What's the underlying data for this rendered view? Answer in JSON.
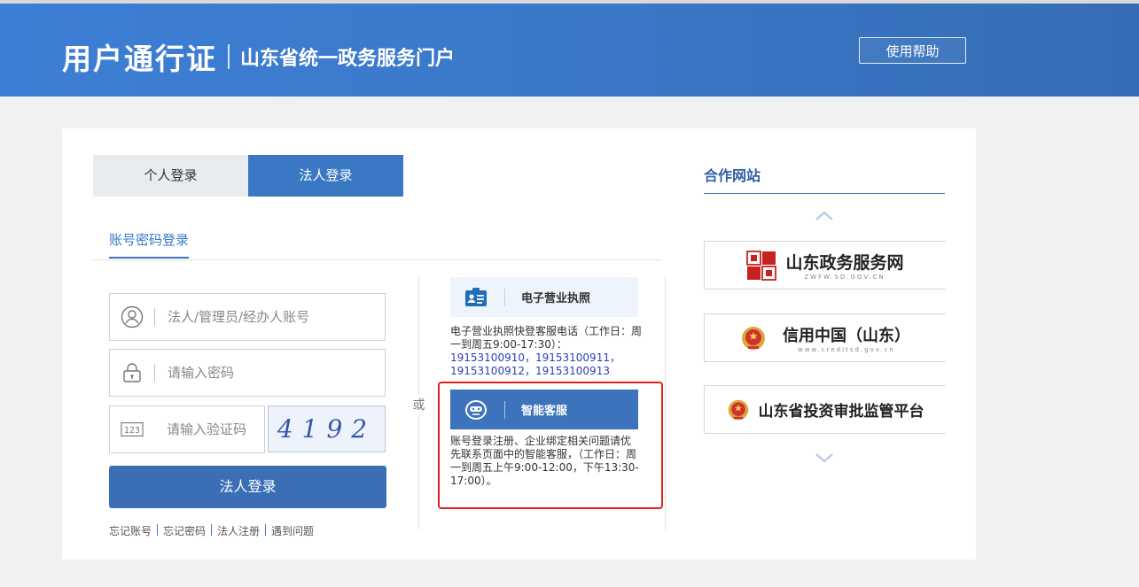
{
  "header": {
    "title": "用户通行证",
    "subtitle": "山东省统一政务服务门户",
    "help_label": "使用帮助"
  },
  "login": {
    "tabs": [
      {
        "label": "个人登录",
        "active": false
      },
      {
        "label": "法人登录",
        "active": true
      }
    ],
    "subnav_label": "账号密码登录",
    "account_placeholder": "法人/管理员/经办人账号",
    "password_placeholder": "请输入密码",
    "captcha_placeholder": "请输入验证码",
    "captcha_text": "4192",
    "submit_label": "法人登录",
    "links": [
      "忘记账号",
      "忘记密码",
      "法人注册",
      "遇到问题"
    ],
    "or_label": "或"
  },
  "info": {
    "license_title": "电子营业执照",
    "license_text": "电子营业执照快登客服电话（工作日：周一到周五9:00-17:30）：",
    "license_phones": "19153100910，19153100911，19153100912，19153100913",
    "service_title": "智能客服",
    "service_text": "账号登录注册、企业绑定相关问题请优先联系页面中的智能客服，（工作日：周一到周五上午9:00-12:00，下午13:30-17:00）。"
  },
  "partners": {
    "title": "合作网站",
    "items": [
      {
        "name": "山东政务服务网",
        "sub": "ZWFW.SD.GOV.CN"
      },
      {
        "name": "信用中国（山东）",
        "sub": "www.creditsd.gov.cn"
      },
      {
        "name": "山东省投资审批监管平台",
        "sub": ""
      }
    ]
  },
  "colors": {
    "primary": "#3a78c3",
    "header": "#3a77c6",
    "highlight_border": "#e02020"
  },
  "icons": [
    "user-icon",
    "lock-icon",
    "captcha-123-icon",
    "license-card-icon",
    "robot-chat-icon",
    "chevron-up-icon",
    "chevron-down-icon",
    "emblem-icon"
  ]
}
